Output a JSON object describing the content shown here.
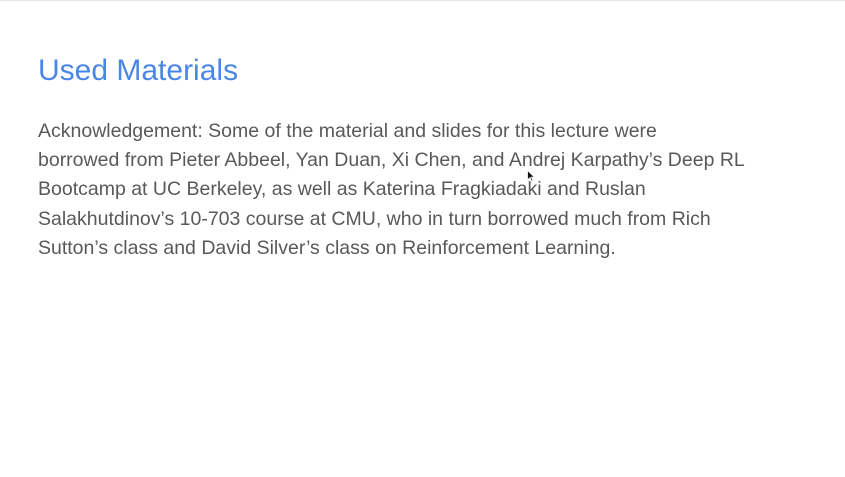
{
  "slide": {
    "title": "Used Materials",
    "body_lines": [
      "Acknowledgement: Some of the material and slides for this lecture were",
      "borrowed from Pieter Abbeel, Yan Duan, Xi Chen, and Andrej Karpathy’s Deep RL",
      "Bootcamp at UC Berkeley, as well as Katerina Fragkiadaki and Ruslan",
      "Salakhutdinov’s 10-703 course at CMU, who in turn borrowed much from Rich",
      "Sutton’s class and David Silver’s class on Reinforcement Learning."
    ]
  },
  "colors": {
    "title": "#4a86e8",
    "body": "#595959",
    "background": "#ffffff"
  },
  "icons": {
    "cursor": "mouse-pointer-icon"
  }
}
